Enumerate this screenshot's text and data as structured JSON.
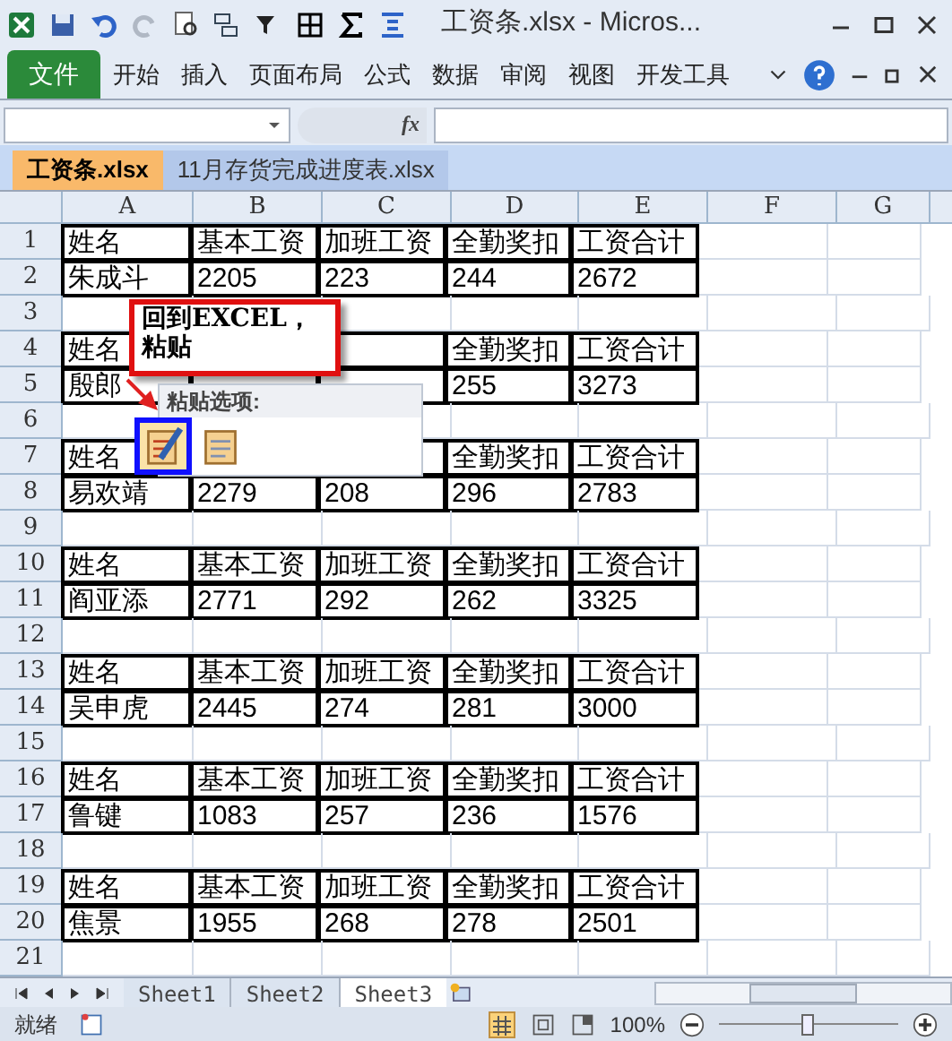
{
  "title_bar": {
    "title": "工资条.xlsx  -  Micros..."
  },
  "ribbon_tabs": [
    {
      "label": "文件",
      "kind": "file",
      "selected": false
    },
    {
      "label": "开始",
      "kind": "tab",
      "selected": false
    },
    {
      "label": "插入",
      "kind": "tab",
      "selected": false
    },
    {
      "label": "页面布局",
      "kind": "tab",
      "selected": false
    },
    {
      "label": "公式",
      "kind": "tab",
      "selected": false
    },
    {
      "label": "数据",
      "kind": "tab",
      "selected": false
    },
    {
      "label": "审阅",
      "kind": "tab",
      "selected": false
    },
    {
      "label": "视图",
      "kind": "tab",
      "selected": false
    },
    {
      "label": "开发工具",
      "kind": "tab",
      "selected": false
    }
  ],
  "formula_bar": {
    "fx": "fx"
  },
  "workbooks": [
    {
      "label": "工资条.xlsx",
      "selected": true
    },
    {
      "label": "11月存货完成进度表.xlsx",
      "selected": false
    }
  ],
  "columns": [
    "A",
    "B",
    "C",
    "D",
    "E",
    "F",
    "G"
  ],
  "rows": [
    {
      "number": "1",
      "kind": "record",
      "A": "姓名",
      "B": "基本工资",
      "C": "加班工资",
      "D": "全勤奖扣",
      "E": "工资合计"
    },
    {
      "number": "2",
      "kind": "record",
      "A": "朱成斗",
      "B": "2205",
      "C": "223",
      "D": "244",
      "E": "2672"
    },
    {
      "number": "3",
      "kind": "blank"
    },
    {
      "number": "4",
      "kind": "record",
      "A": "姓名",
      "D": "全勤奖扣",
      "E": "工资合计"
    },
    {
      "number": "5",
      "kind": "record",
      "A": "殷郎",
      "D": "255",
      "E": "3273"
    },
    {
      "number": "6",
      "kind": "blank"
    },
    {
      "number": "7",
      "kind": "record",
      "A": "姓名",
      "D": "全勤奖扣",
      "E": "工资合计"
    },
    {
      "number": "8",
      "kind": "record",
      "A": "易欢靖",
      "B": "2279",
      "C": "208",
      "D": "296",
      "E": "2783"
    },
    {
      "number": "9",
      "kind": "blank"
    },
    {
      "number": "10",
      "kind": "record",
      "A": "姓名",
      "B": "基本工资",
      "C": "加班工资",
      "D": "全勤奖扣",
      "E": "工资合计"
    },
    {
      "number": "11",
      "kind": "record",
      "A": "阎亚添",
      "B": "2771",
      "C": "292",
      "D": "262",
      "E": "3325"
    },
    {
      "number": "12",
      "kind": "blank"
    },
    {
      "number": "13",
      "kind": "record",
      "A": "姓名",
      "B": "基本工资",
      "C": "加班工资",
      "D": "全勤奖扣",
      "E": "工资合计"
    },
    {
      "number": "14",
      "kind": "record",
      "A": "吴申虎",
      "B": "2445",
      "C": "274",
      "D": "281",
      "E": "3000"
    },
    {
      "number": "15",
      "kind": "blank"
    },
    {
      "number": "16",
      "kind": "record",
      "A": "姓名",
      "B": "基本工资",
      "C": "加班工资",
      "D": "全勤奖扣",
      "E": "工资合计"
    },
    {
      "number": "17",
      "kind": "record",
      "A": "鲁键",
      "B": "1083",
      "C": "257",
      "D": "236",
      "E": "1576"
    },
    {
      "number": "18",
      "kind": "blank"
    },
    {
      "number": "19",
      "kind": "record",
      "A": "姓名",
      "B": "基本工资",
      "C": "加班工资",
      "D": "全勤奖扣",
      "E": "工资合计"
    },
    {
      "number": "20",
      "kind": "record",
      "A": "焦景",
      "B": "1955",
      "C": "268",
      "D": "278",
      "E": "2501"
    },
    {
      "number": "21",
      "kind": "blank"
    }
  ],
  "callout": {
    "text": "回到EXCEL，粘贴"
  },
  "paste_options": {
    "title": "粘贴选项:"
  },
  "sheets": [
    {
      "label": "Sheet1",
      "selected": false
    },
    {
      "label": "Sheet2",
      "selected": false
    },
    {
      "label": "Sheet3",
      "selected": true
    }
  ],
  "status_bar": {
    "status": "就绪",
    "zoom": "100%",
    "zoom_slider": {
      "level": 0.5
    }
  }
}
